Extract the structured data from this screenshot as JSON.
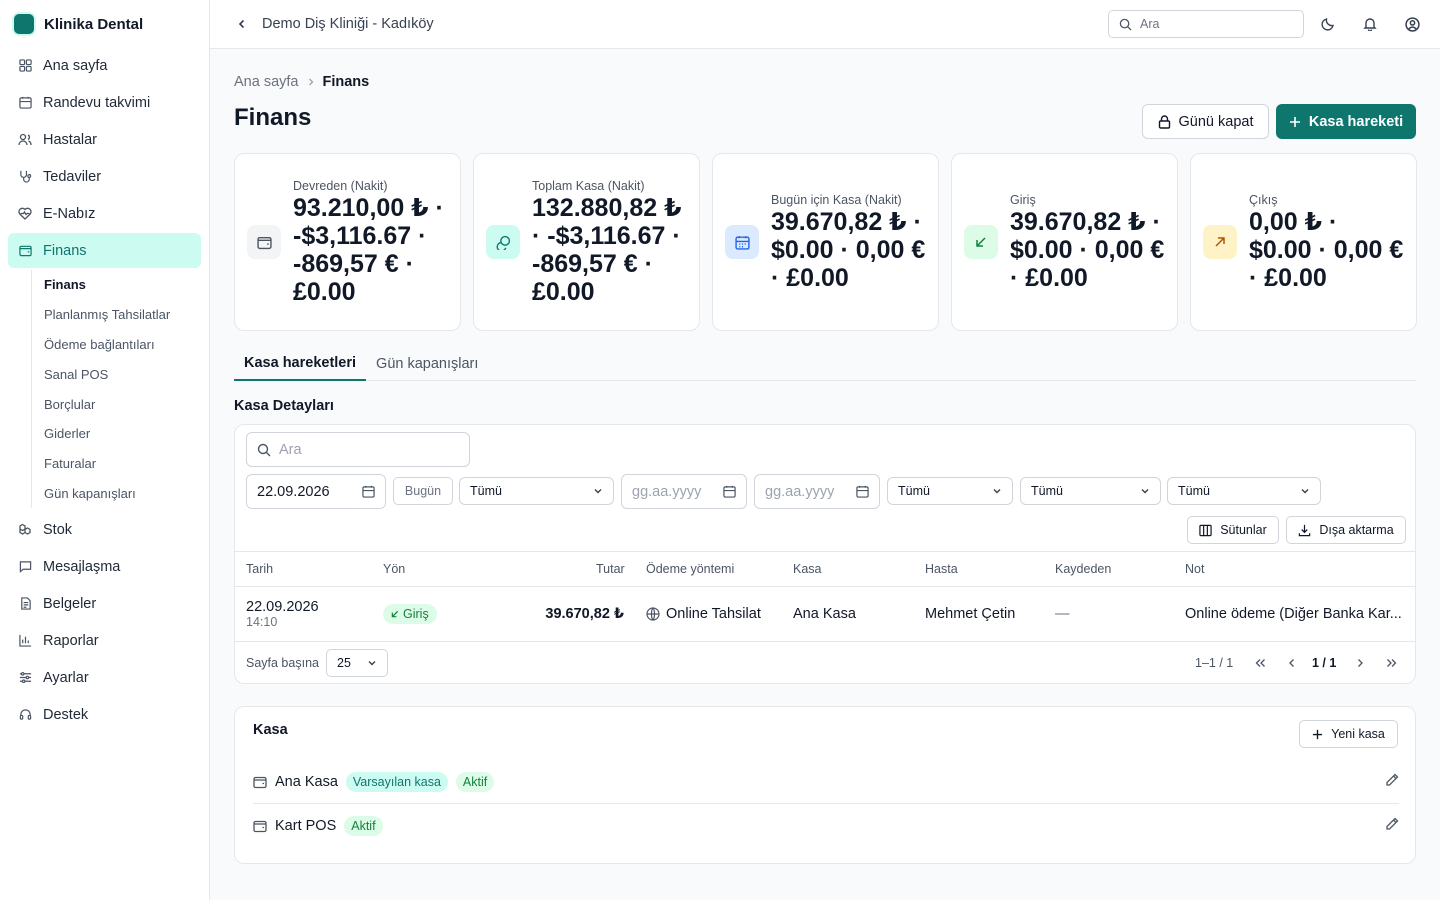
{
  "brand": {
    "name": "Klinika Dental"
  },
  "sidebar": {
    "items": [
      {
        "label": "Ana sayfa",
        "icon": "grid-icon"
      },
      {
        "label": "Randevu takvimi",
        "icon": "calendar-icon"
      },
      {
        "label": "Hastalar",
        "icon": "users-icon"
      },
      {
        "label": "Tedaviler",
        "icon": "stethoscope-icon"
      },
      {
        "label": "E-Nabız",
        "icon": "heart-pulse-icon"
      },
      {
        "label": "Finans",
        "icon": "wallet-icon"
      },
      {
        "label": "Stok",
        "icon": "boxes-icon"
      },
      {
        "label": "Mesajlaşma",
        "icon": "message-icon"
      },
      {
        "label": "Belgeler",
        "icon": "document-icon"
      },
      {
        "label": "Raporlar",
        "icon": "bar-chart-icon"
      },
      {
        "label": "Ayarlar",
        "icon": "sliders-icon"
      },
      {
        "label": "Destek",
        "icon": "headset-icon"
      }
    ],
    "finans_sub": [
      "Finans",
      "Planlanmış Tahsilatlar",
      "Ödeme bağlantıları",
      "Sanal POS",
      "Borçlular",
      "Giderler",
      "Faturalar",
      "Gün kapanışları"
    ]
  },
  "topbar": {
    "clinic": "Demo Diş Kliniği - Kadıköy",
    "search_placeholder": "Ara"
  },
  "breadcrumb": {
    "home": "Ana sayfa",
    "current": "Finans"
  },
  "page": {
    "title": "Finans",
    "close_day": "Günü kapat",
    "cash_move": "Kasa hareketi"
  },
  "cards": [
    {
      "label": "Devreden (Nakit)",
      "value": "93.210,00 ₺ · -$3,116.67 · -869,57 € · £0.00"
    },
    {
      "label": "Toplam Kasa (Nakit)",
      "value": "132.880,82 ₺ · -$3,116.67 · -869,57 € · £0.00"
    },
    {
      "label": "Bugün için Kasa (Nakit)",
      "value": "39.670,82 ₺ · $0.00 · 0,00 € · £0.00"
    },
    {
      "label": "Giriş",
      "value": "39.670,82 ₺ · $0.00 · 0,00 € · £0.00"
    },
    {
      "label": "Çıkış",
      "value": "0,00 ₺ · $0.00 · 0,00 € · £0.00"
    }
  ],
  "tabs": [
    "Kasa hareketleri",
    "Gün kapanışları"
  ],
  "details": {
    "title": "Kasa Detayları",
    "search_placeholder": "Ara",
    "date": "22.09.2026",
    "today": "Bugün",
    "all": "Tümü",
    "date_placeholder": "gg.aa.yyyy",
    "columns_btn": "Sütunlar",
    "export_btn": "Dışa aktarma"
  },
  "table": {
    "headers": [
      "Tarih",
      "Yön",
      "Tutar",
      "Ödeme yöntemi",
      "Kasa",
      "Hasta",
      "Kaydeden",
      "Not"
    ],
    "row": {
      "date": "22.09.2026",
      "time": "14:10",
      "direction": "Giriş",
      "amount": "39.670,82 ₺",
      "method": "Online Tahsilat",
      "kasa": "Ana Kasa",
      "patient": "Mehmet Çetin",
      "recorder": "—",
      "note": "Online ödeme (Diğer Banka Kar..."
    }
  },
  "pager": {
    "per_page_label": "Sayfa başına",
    "per_page": "25",
    "range": "1–1 / 1",
    "page": "1 / 1"
  },
  "kasa": {
    "title": "Kasa",
    "new_btn": "Yeni kasa",
    "rows": [
      {
        "name": "Ana Kasa",
        "default": "Varsayılan kasa",
        "status": "Aktif"
      },
      {
        "name": "Kart POS",
        "status": "Aktif"
      }
    ]
  },
  "colors": {
    "accent": "#0f766e",
    "accent_light": "#ccfbf1",
    "success": "#15803d",
    "success_light": "#dcfce7"
  }
}
